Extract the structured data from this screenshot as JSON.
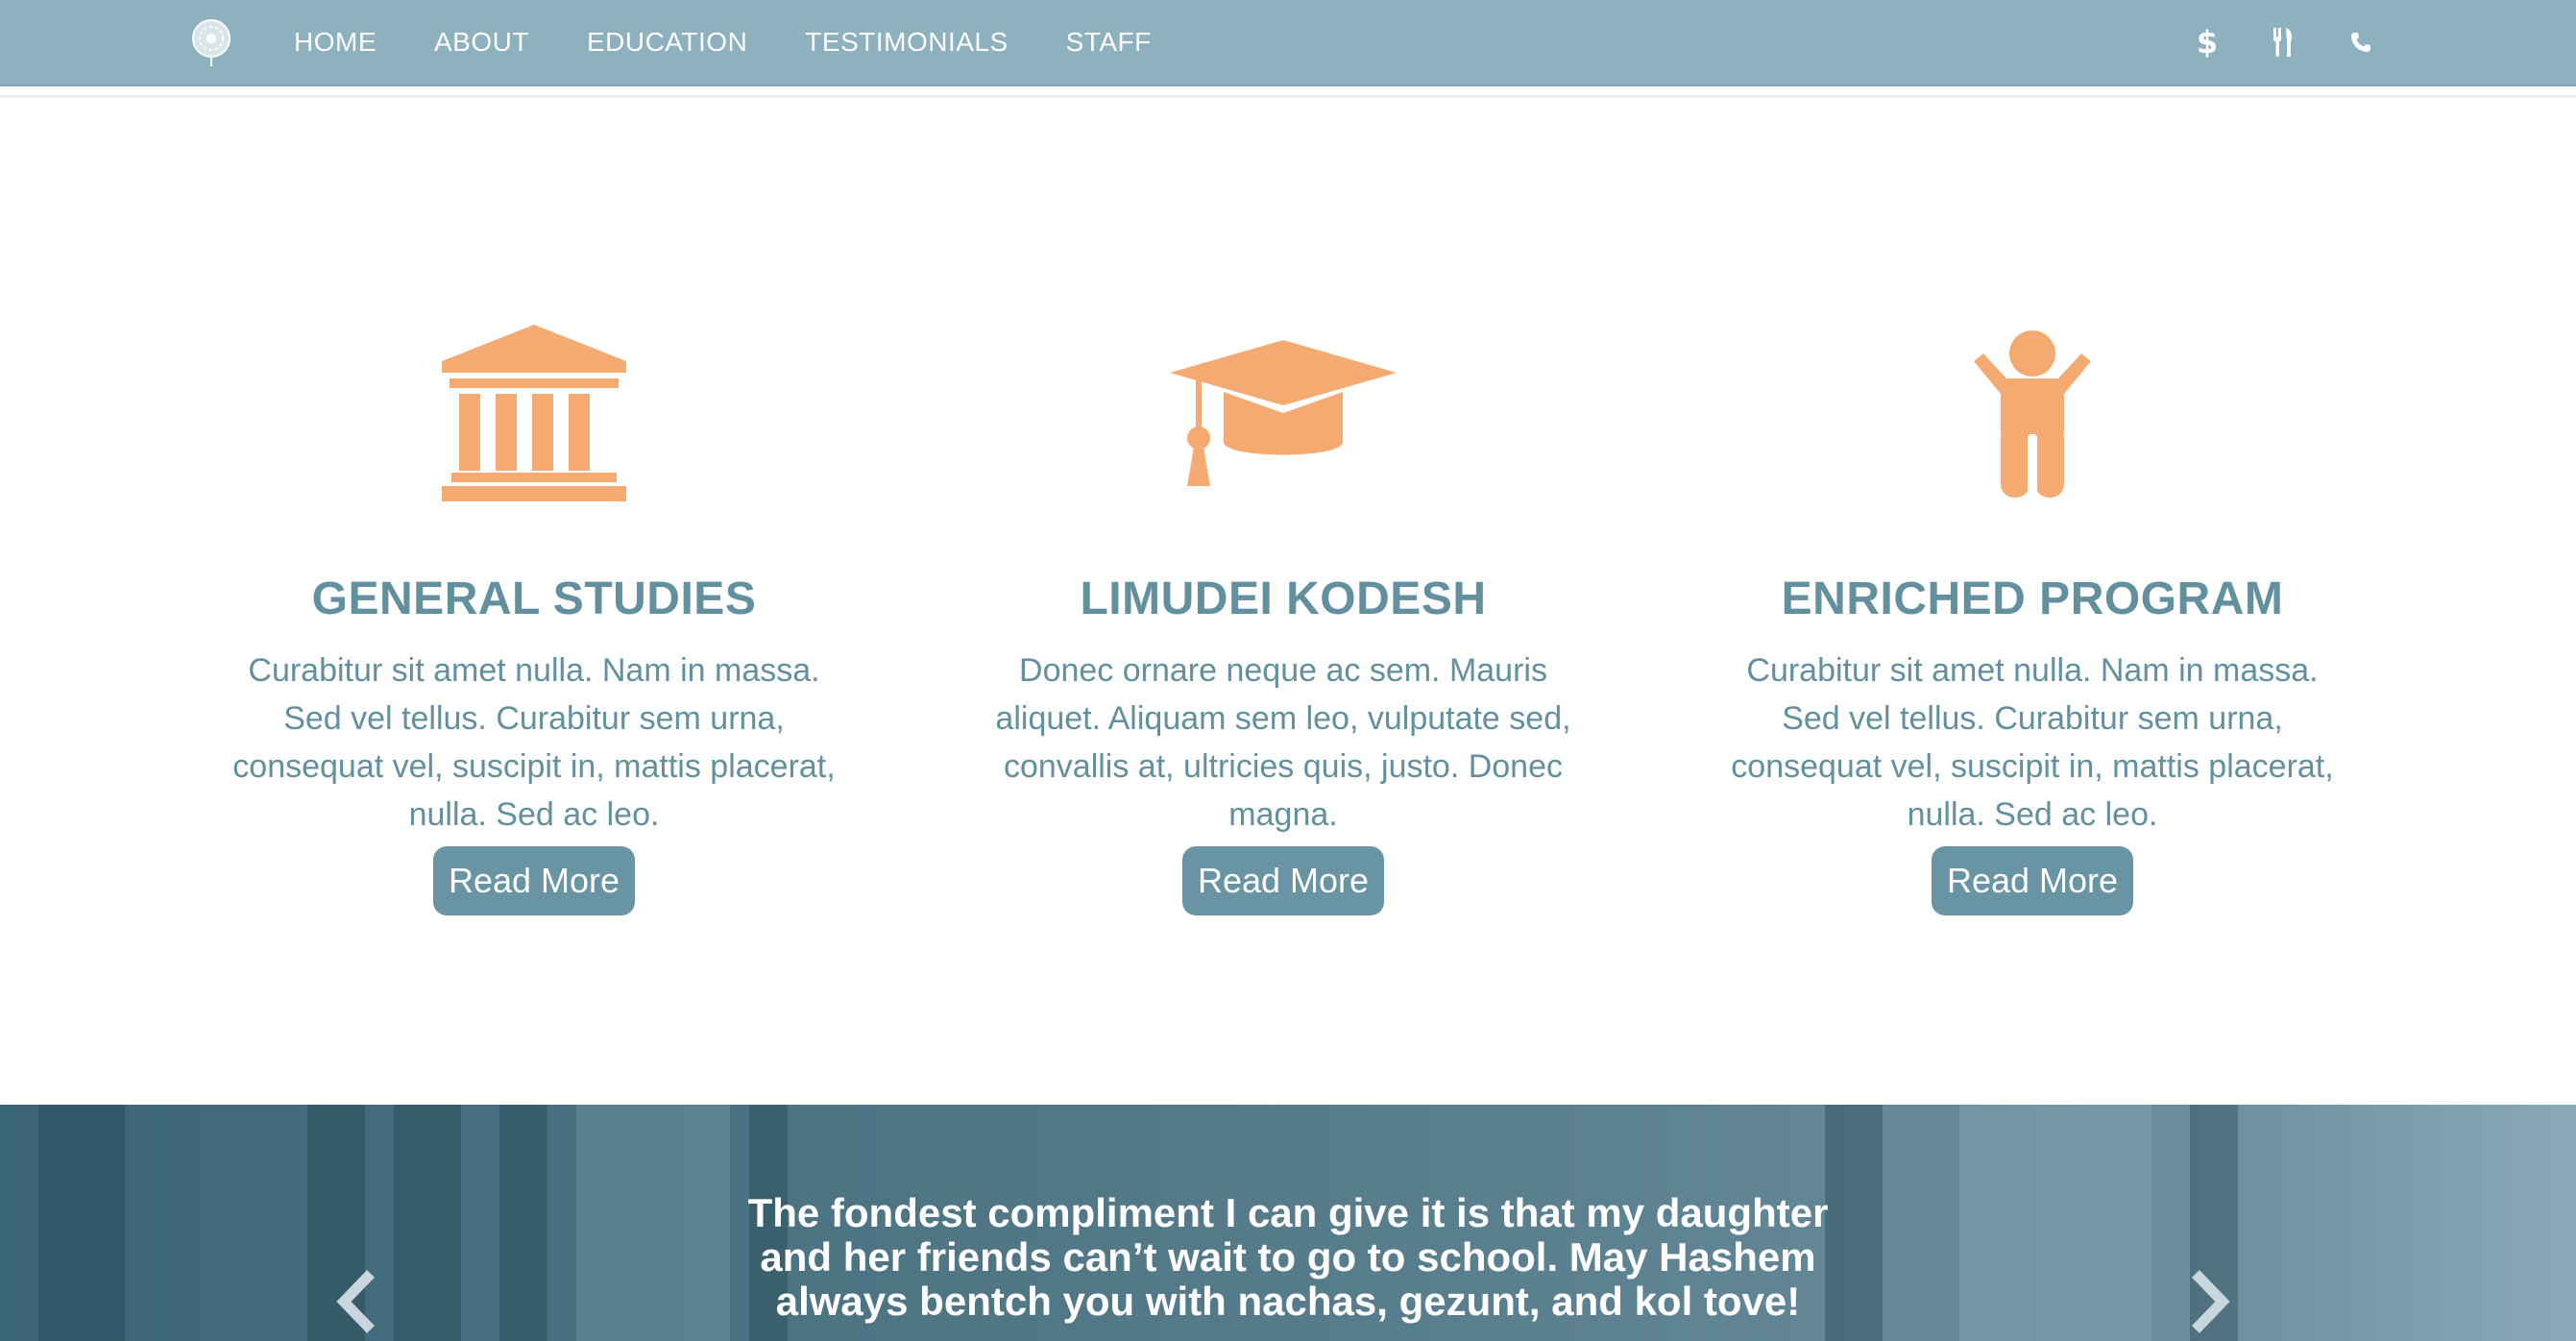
{
  "nav": {
    "links": [
      "HOME",
      "ABOUT",
      "EDUCATION",
      "TESTIMONIALS",
      "STAFF"
    ],
    "icons": {
      "dollar": "$",
      "menu": "utensils-icon",
      "phone": "phone-icon"
    }
  },
  "features": [
    {
      "icon": "bank-icon",
      "title": "GENERAL STUDIES",
      "text": "Curabitur sit amet nulla. Nam in massa. Sed vel tellus. Curabitur sem urna, consequat vel, suscipit in, mattis placerat, nulla. Sed ac leo.",
      "button": "Read More"
    },
    {
      "icon": "graduation-cap-icon",
      "title": "LIMUDEI KODESH",
      "text": "Donec ornare neque ac sem. Mauris aliquet. Aliquam sem leo, vulputate sed, convallis at, ultricies quis, justo. Donec magna.",
      "button": "Read More"
    },
    {
      "icon": "child-icon",
      "title": "ENRICHED PROGRAM",
      "text": "Curabitur sit amet nulla. Nam in massa. Sed vel tellus. Curabitur sem urna, consequat vel, suscipit in, mattis placerat, nulla. Sed ac leo.",
      "button": "Read More"
    }
  ],
  "testimonial": {
    "lines": [
      "The fondest compliment I can give it is that my daughter",
      "and her friends can’t wait to go to school. May Hashem",
      "always bentch you with nachas, gezunt, and kol tove!"
    ]
  },
  "colors": {
    "nav": "#8db1be",
    "accent_orange": "#f5aa72",
    "heading": "#62909f",
    "button": "#6994a4"
  }
}
